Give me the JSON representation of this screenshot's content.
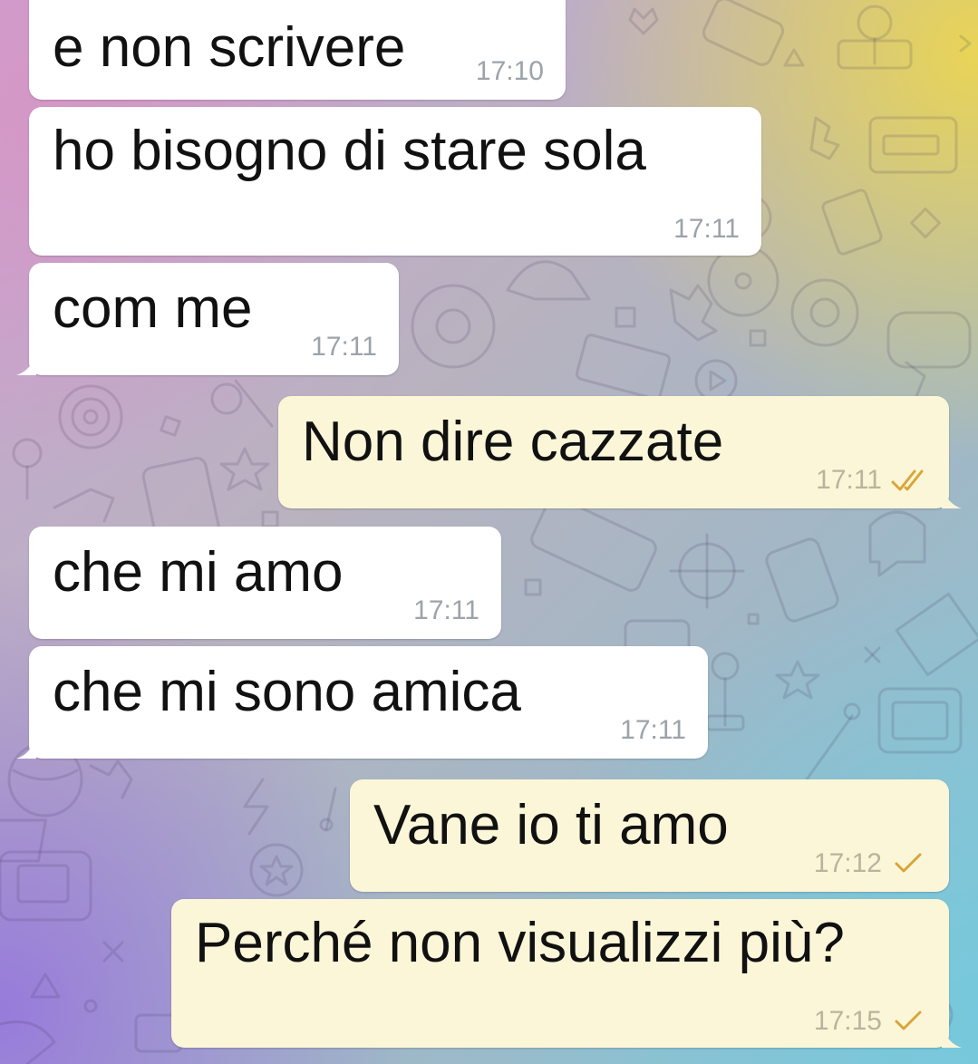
{
  "chat": {
    "messages": [
      {
        "text": "e non scrivere",
        "time": "17:10",
        "direction": "incoming"
      },
      {
        "text": "ho bisogno di stare sola",
        "time": "17:11",
        "direction": "incoming"
      },
      {
        "text": "com me",
        "time": "17:11",
        "direction": "incoming"
      },
      {
        "text": "Non dire cazzate",
        "time": "17:11",
        "direction": "outgoing",
        "status": "read"
      },
      {
        "text": "che mi amo",
        "time": "17:11",
        "direction": "incoming"
      },
      {
        "text": "che mi sono amica",
        "time": "17:11",
        "direction": "incoming"
      },
      {
        "text": "Vane io ti amo",
        "time": "17:12",
        "direction": "outgoing",
        "status": "sent"
      },
      {
        "text": "Perché non visualizzi più?",
        "time": "17:15",
        "direction": "outgoing",
        "status": "sent"
      }
    ],
    "icons": {
      "double_check": "double-check-icon",
      "single_check": "check-icon"
    },
    "colors": {
      "incoming_bubble": "#ffffff",
      "outgoing_bubble": "#fcf6d8",
      "check_color": "#d9a53a",
      "time_color": "#9ca3a9"
    }
  }
}
